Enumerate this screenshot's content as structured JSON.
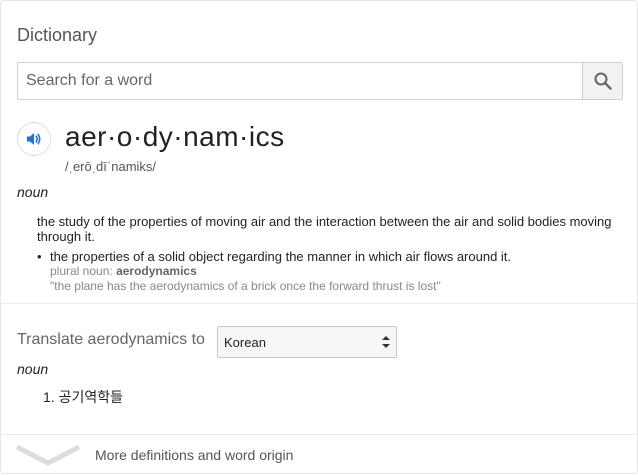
{
  "card": {
    "title": "Dictionary"
  },
  "search": {
    "placeholder": "Search for a word",
    "icon": "search-icon"
  },
  "entry": {
    "speaker_icon": "speaker-icon",
    "headword": "aer·o·dy·nam·ics",
    "phonetic": "/ˌerōˌdīˈnamiks/",
    "part_of_speech": "noun",
    "definitions": [
      {
        "text": "the study of the properties of moving air and the interaction between the air and solid bodies moving through it."
      },
      {
        "text": "the properties of a solid object regarding the manner in which air flows around it.",
        "plural_label": "plural noun:",
        "plural_word": "aerodynamics",
        "example": "\"the plane has the aerodynamics of a brick once the forward thrust is lost\""
      }
    ]
  },
  "translate": {
    "label": "Translate aerodynamics to",
    "language": "Korean",
    "part_of_speech": "noun",
    "results": [
      "1. 공기역학들"
    ]
  },
  "more": {
    "label": "More definitions and word origin",
    "icon": "chevron-down-icon"
  },
  "colors": {
    "accent_blue": "#1a73e8",
    "border": "#d0d0d0",
    "muted": "#888888"
  }
}
